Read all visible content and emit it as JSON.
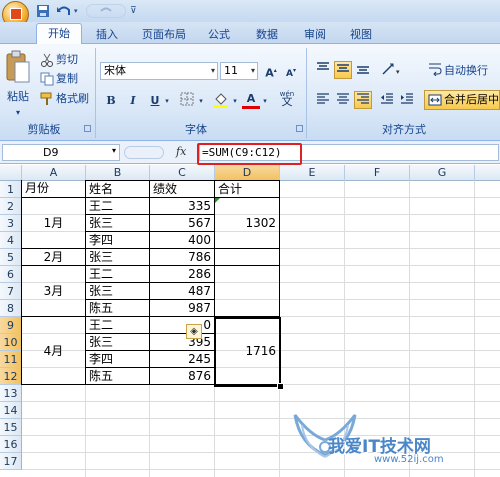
{
  "title_bar": {
    "undo_icon": "undo-icon",
    "redo_icon": "redo-icon"
  },
  "tabs": [
    "开始",
    "插入",
    "页面布局",
    "公式",
    "数据",
    "审阅",
    "视图"
  ],
  "ribbon": {
    "clipboard": {
      "paste": "粘贴",
      "cut": "剪切",
      "copy": "复制",
      "format_painter": "格式刷",
      "label": "剪贴板"
    },
    "font": {
      "name": "宋体",
      "size": "11",
      "bold": "B",
      "italic": "I",
      "underline": "U",
      "grow": "A",
      "shrink": "A",
      "font_color": "A",
      "phonetic": "wén",
      "label": "字体"
    },
    "alignment": {
      "wrap": "自动换行",
      "merge": "合并后居中",
      "label": "对齐方式"
    }
  },
  "formula_bar": {
    "name_box": "D9",
    "fx": "fx",
    "formula": "=SUM(C9:C12)"
  },
  "columns": [
    "A",
    "B",
    "C",
    "D",
    "E",
    "F",
    "G"
  ],
  "rows": [
    "1",
    "2",
    "3",
    "4",
    "5",
    "6",
    "7",
    "8",
    "9",
    "10",
    "11",
    "12",
    "13",
    "14",
    "15",
    "16",
    "17"
  ],
  "table": {
    "headers": {
      "month": "月份",
      "name": "姓名",
      "perf": "绩效",
      "total": "合计"
    },
    "groups": [
      {
        "month": "1月",
        "total": "1302"
      },
      {
        "month": "2月",
        "total": ""
      },
      {
        "month": "3月",
        "total": ""
      },
      {
        "month": "4月",
        "total": "1716"
      }
    ],
    "rows": [
      {
        "name": "王二",
        "perf": "335"
      },
      {
        "name": "张三",
        "perf": "567"
      },
      {
        "name": "李四",
        "perf": "400"
      },
      {
        "name": "张三",
        "perf": "786"
      },
      {
        "name": "王二",
        "perf": "286"
      },
      {
        "name": "张三",
        "perf": "487"
      },
      {
        "name": "陈五",
        "perf": "987"
      },
      {
        "name": "王二",
        "perf": "0"
      },
      {
        "name": "张三",
        "perf": "395"
      },
      {
        "name": "李四",
        "perf": "245"
      },
      {
        "name": "陈五",
        "perf": "876"
      }
    ]
  },
  "watermark": {
    "text": "我爱IT技术网",
    "url": "www.52ij.com"
  },
  "colors": {
    "ribbon": "#dbe8f6",
    "selection_header": "#f1c15f",
    "highlight": "#e02020"
  }
}
